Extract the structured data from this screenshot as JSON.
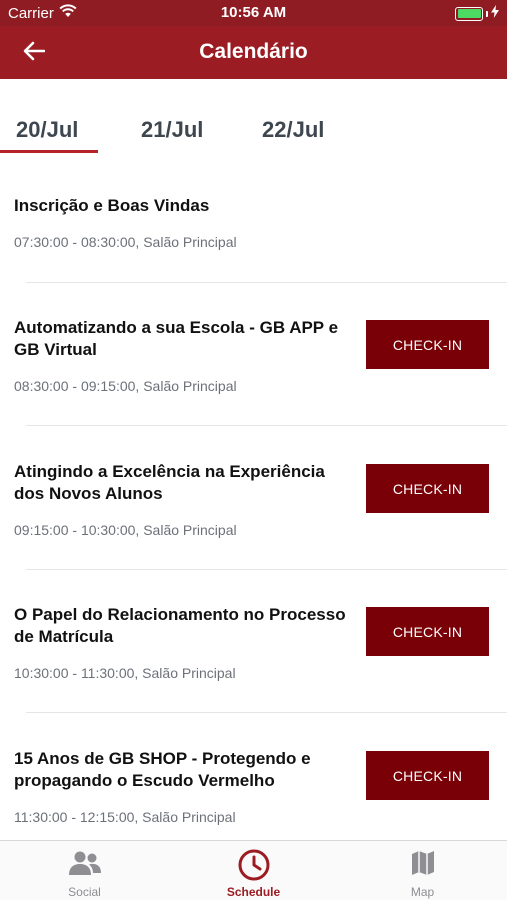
{
  "status_bar": {
    "carrier": "Carrier",
    "time": "10:56 AM"
  },
  "nav": {
    "title": "Calendário"
  },
  "date_tabs": [
    {
      "label": "20/Jul",
      "selected": true
    },
    {
      "label": "21/Jul",
      "selected": false
    },
    {
      "label": "22/Jul",
      "selected": false
    }
  ],
  "sessions": [
    {
      "title": "Inscrição e Boas Vindas",
      "meta": "07:30:00 - 08:30:00, Salão Principal",
      "checkin": ""
    },
    {
      "title": "Automatizando a sua Escola - GB APP e GB Virtual",
      "meta": "08:30:00 - 09:15:00, Salão Principal",
      "checkin": "CHECK-IN"
    },
    {
      "title": "Atingindo a Excelência na Experiência dos Novos Alunos",
      "meta": "09:15:00 - 10:30:00, Salão Principal",
      "checkin": "CHECK-IN"
    },
    {
      "title": "O Papel do Relacionamento no Processo de Matrícula",
      "meta": "10:30:00 - 11:30:00, Salão Principal",
      "checkin": "CHECK-IN"
    },
    {
      "title": "15 Anos de GB SHOP - Protegendo e propagando o Escudo Vermelho",
      "meta": "11:30:00 - 12:15:00, Salão Principal",
      "checkin": "CHECK-IN"
    }
  ],
  "tabbar": {
    "items": [
      {
        "label": "Social",
        "icon": "people-icon"
      },
      {
        "label": "Schedule",
        "icon": "clock-icon"
      },
      {
        "label": "Map",
        "icon": "map-icon"
      }
    ],
    "active": "Schedule"
  },
  "colors": {
    "brand": "#9b1c22",
    "button": "#7a0008",
    "battery": "#4cd964"
  }
}
